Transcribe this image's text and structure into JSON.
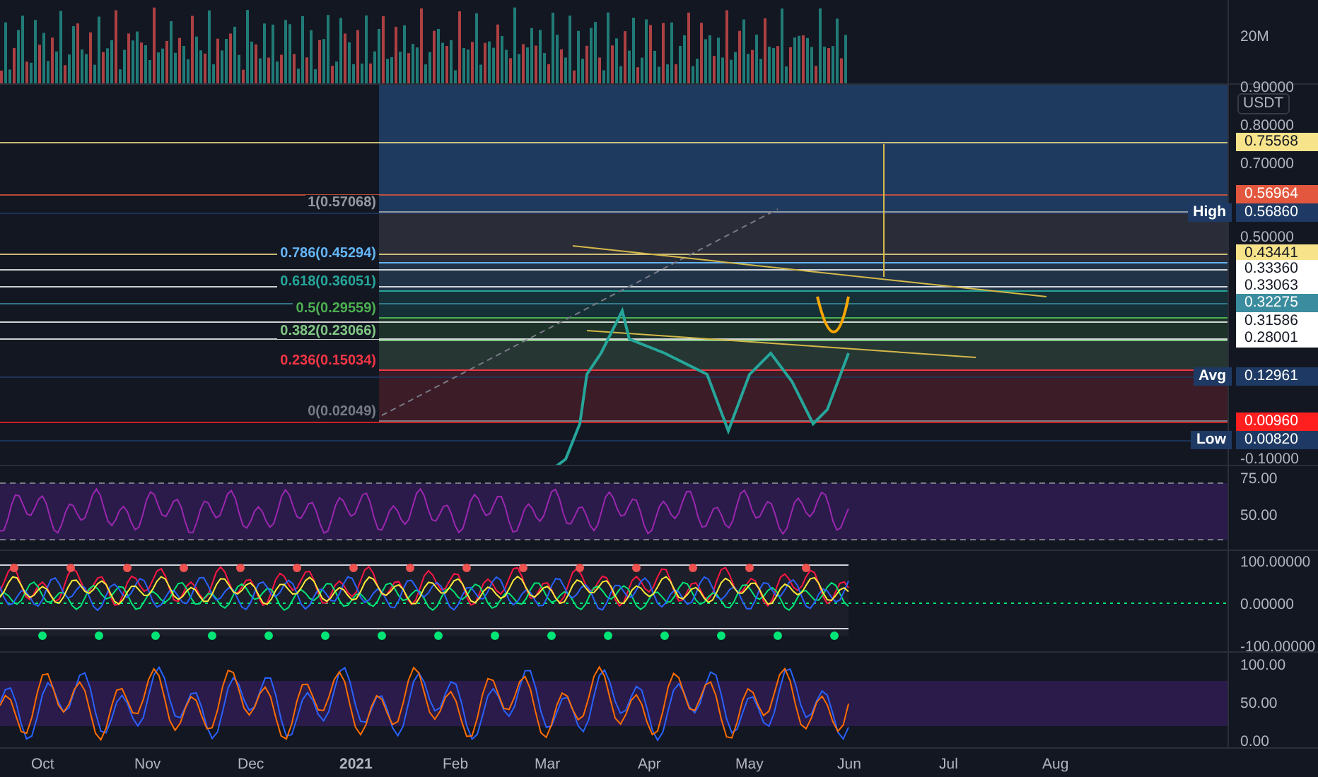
{
  "volume_panel": {
    "axis_labels": [
      "20M"
    ]
  },
  "price_panel": {
    "currency": "USDT",
    "axis_labels": [
      "0.90000",
      "0.80000",
      "0.70000",
      "0.50000",
      "-0.10000"
    ],
    "fib_levels": [
      {
        "label": "1(0.57068)",
        "color": "#9598a1"
      },
      {
        "label": "0.786(0.45294)",
        "color": "#64b5f6"
      },
      {
        "label": "0.618(0.36051)",
        "color": "#26a69a"
      },
      {
        "label": "0.5(0.29559)",
        "color": "#4caf50"
      },
      {
        "label": "0.382(0.23066)",
        "color": "#81c784"
      },
      {
        "label": "0.236(0.15034)",
        "color": "#f23645"
      },
      {
        "label": "0(0.02049)",
        "color": "#787b86"
      }
    ],
    "price_tags": [
      {
        "value": "0.75568",
        "color": "#f7e38a"
      },
      {
        "value": "0.56964",
        "color": "#e2573d"
      },
      {
        "name": "High",
        "value": "0.56860",
        "color": "#1e3a64"
      },
      {
        "value": "0.43441",
        "color": "#f7e38a"
      },
      {
        "value": "0.33360",
        "color": "#ffffff"
      },
      {
        "value": "0.33063",
        "color": "#ffffff"
      },
      {
        "value": "0.32275",
        "color": "#3a8c9e"
      },
      {
        "value": "0.31586",
        "color": "#ffffff"
      },
      {
        "value": "0.28001",
        "color": "#ffffff"
      },
      {
        "name": "Avg",
        "value": "0.12961",
        "color": "#1e3a64"
      },
      {
        "value": "0.00960",
        "color": "#ff1f1f"
      },
      {
        "name": "Low",
        "value": "0.00820",
        "color": "#1e3a64"
      }
    ]
  },
  "rsi_panel": {
    "axis_labels": [
      "75.00",
      "50.00"
    ]
  },
  "oscillator_panel": {
    "axis_labels": [
      "100.00000",
      "0.00000",
      "-100.00000"
    ]
  },
  "stoch_panel": {
    "axis_labels": [
      "100.00",
      "50.00",
      "0.00"
    ]
  },
  "time_axis": [
    {
      "label": "Oct",
      "bold": false
    },
    {
      "label": "Nov",
      "bold": false
    },
    {
      "label": "Dec",
      "bold": false
    },
    {
      "label": "2021",
      "bold": true
    },
    {
      "label": "Feb",
      "bold": false
    },
    {
      "label": "Mar",
      "bold": false
    },
    {
      "label": "Apr",
      "bold": false
    },
    {
      "label": "May",
      "bold": false
    },
    {
      "label": "Jun",
      "bold": false
    },
    {
      "label": "Jul",
      "bold": false
    },
    {
      "label": "Aug",
      "bold": false
    }
  ]
}
